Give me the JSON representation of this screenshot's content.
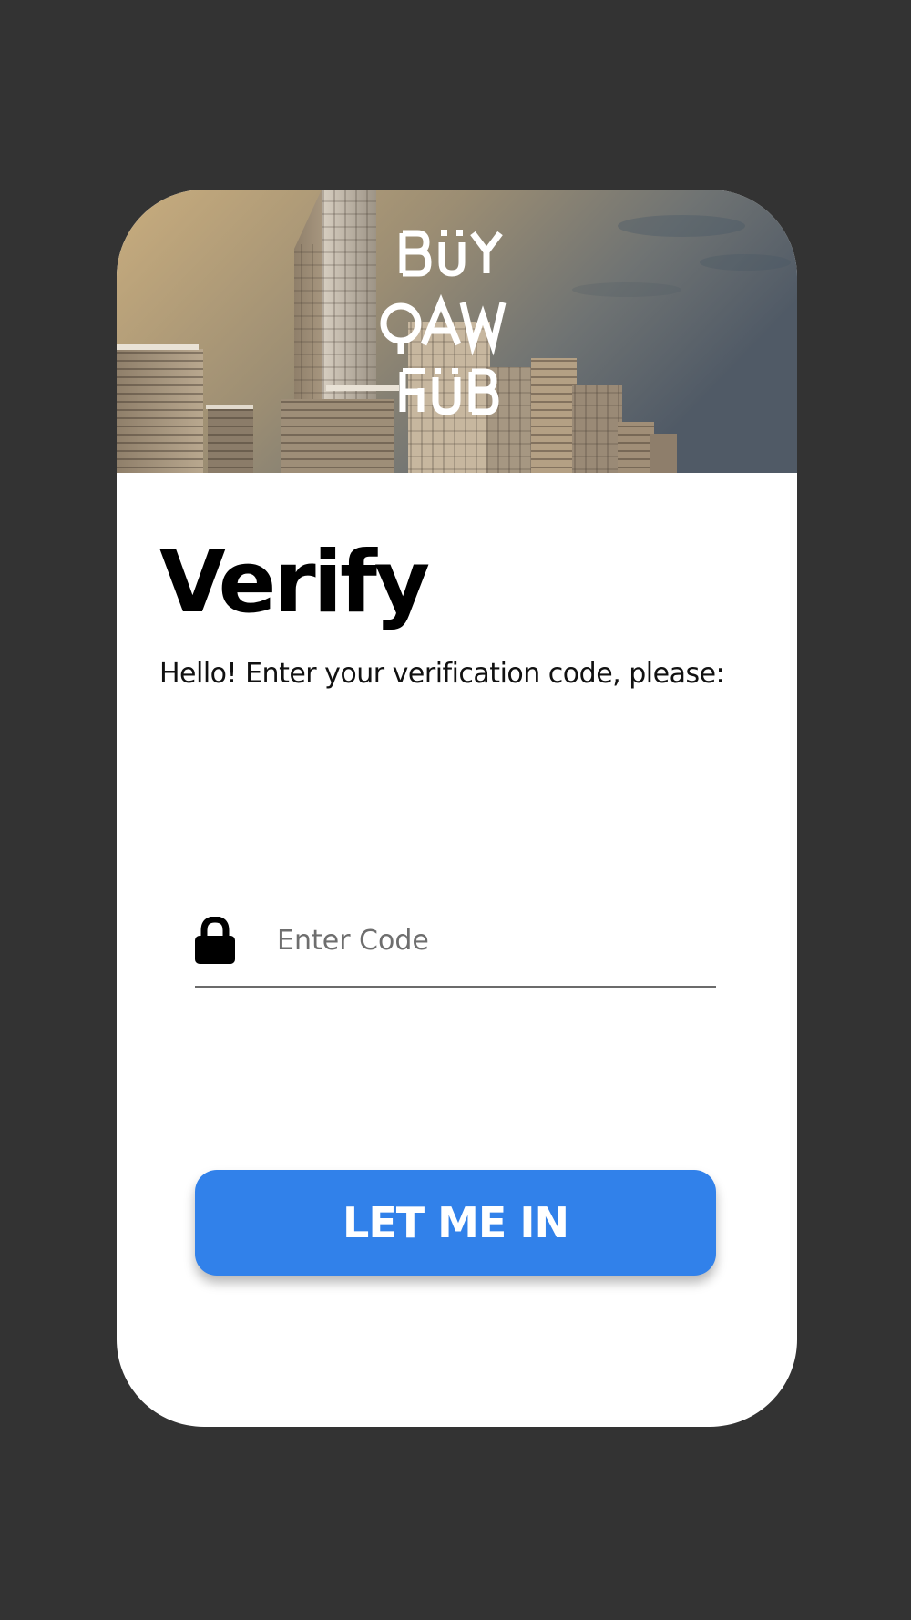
{
  "brand": {
    "logo_lines": [
      "BUY",
      "QAW",
      "HUB"
    ]
  },
  "verify": {
    "title": "Verify",
    "subtitle": "Hello! Enter your verification code, please:"
  },
  "code_field": {
    "placeholder": "Enter Code",
    "value": "",
    "icon": "lock-icon"
  },
  "submit": {
    "label": "LET ME IN"
  },
  "colors": {
    "page_background": "#333333",
    "card_background": "#FFFFFF",
    "accent": "#3181EA",
    "button_text": "#FFFFFF",
    "title_text": "#000000",
    "placeholder_text": "#6E6E6E"
  }
}
